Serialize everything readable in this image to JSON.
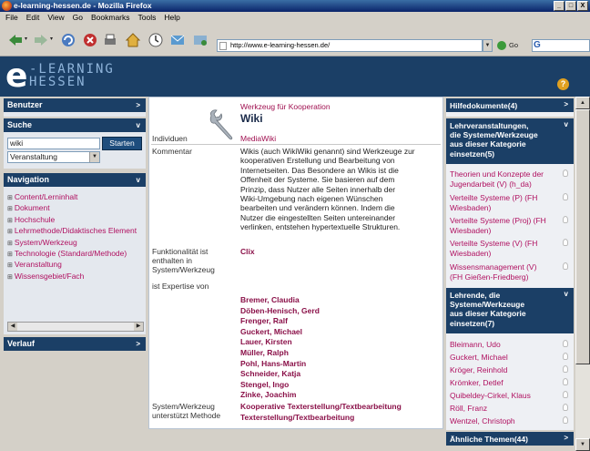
{
  "window": {
    "title": "e-learning-hessen.de - Mozilla Firefox",
    "controls": [
      "_",
      "□",
      "X"
    ]
  },
  "menu": [
    "File",
    "Edit",
    "View",
    "Go",
    "Bookmarks",
    "Tools",
    "Help"
  ],
  "navbar": {
    "url": "http://www.e-learning-hessen.de/",
    "go_label": "Go",
    "search_value": ""
  },
  "header": {
    "logo_letter": "e",
    "logo_line1": "-LEARNING",
    "logo_line2": "HESSEN",
    "help_icon": "?"
  },
  "left": {
    "benutzer": "Benutzer",
    "suche": "Suche",
    "search_value": "wiki",
    "start_label": "Starten",
    "select_value": "Veranstaltung",
    "navigation": "Navigation",
    "nav_items": [
      "Content/Lerninhalt",
      "Dokument",
      "Hochschule",
      "Lehrmethode/Didaktisches Element",
      "System/Werkzeug",
      "Technologie (Standard/Methode)",
      "Veranstaltung",
      "Wissensgebiet/Fach"
    ],
    "verlauf": "Verlauf"
  },
  "content": {
    "category": "Werkzeug für Kooperation",
    "title": "Wiki",
    "individuen_label": "Individuen",
    "individuen_value": "MediaWiki",
    "kommentar_label": "Kommentar",
    "kommentar_text": [
      "Wikis (auch WikiWiki genannt) sind Werkzeuge zur",
      "kooperativen Erstellung und Bearbeitung von",
      "Internetseiten. Das Besondere an Wikis ist die",
      "Offenheit der Systeme. Sie basieren auf dem",
      "Prinzip, dass Nutzer alle Seiten innerhalb der",
      "Wiki-Umgebung nach eigenen Wünschen",
      "bearbeiten und verändern können. Indem die",
      "Nutzer die eingestellten Seiten untereinander",
      "verlinken, entstehen hypertextuelle Strukturen."
    ],
    "funktionalitaet_label": [
      "Funktionalität ist",
      "enthalten in",
      "System/Werkzeug"
    ],
    "funktionalitaet_value": "Clix",
    "expertise_label": "ist Expertise von",
    "experts": [
      "Bremer, Claudia",
      "Döben-Henisch, Gerd",
      "Frenger, Ralf",
      "Guckert, Michael",
      "Lauer, Kirsten",
      "Müller, Ralph",
      "Pohl, Hans-Martin",
      "Schneider, Katja",
      "Stengel, Ingo",
      "Zinke, Joachim"
    ],
    "methode_label": [
      "System/Werkzeug",
      "unterstützt Methode"
    ],
    "methoden": [
      "Kooperative Texterstellung/Textbearbeitung",
      "Texterstellung/Textbearbeitung"
    ]
  },
  "right": {
    "hilfedokumente": "Hilfedokumente(4)",
    "lehrveranstaltungen_head": [
      "Lehrveranstaltungen,",
      "die Systeme/Werkzeuge",
      "aus dieser Kategorie",
      "einsetzen(5)"
    ],
    "lehrveranstaltungen": [
      [
        "Theorien und Konzepte der",
        "Jugendarbeit (V) (h_da)"
      ],
      [
        "Verteilte Systeme (P) (FH",
        "Wiesbaden)"
      ],
      [
        "Verteilte Systeme (Proj) (FH",
        "Wiesbaden)"
      ],
      [
        "Verteilte Systeme (V) (FH",
        "Wiesbaden)"
      ],
      [
        "Wissensmanagement (V)",
        "(FH Gießen-Friedberg)"
      ]
    ],
    "lehrende_head": [
      "Lehrende, die",
      "Systeme/Werkzeuge",
      "aus dieser Kategorie",
      "einsetzen(7)"
    ],
    "lehrende": [
      "Bleimann, Udo",
      "Guckert, Michael",
      "Kröger, Reinhold",
      "Krömker, Detlef",
      "Quibeldey-Cirkel, Klaus",
      "Röll, Franz",
      "Wentzel, Christoph"
    ],
    "aehnliche": "Ähnliche Themen(44)"
  },
  "colors": {
    "header_blue": "#1b3f66",
    "link_magenta": "#b01060",
    "panel_bg": "#e4e8ee"
  }
}
